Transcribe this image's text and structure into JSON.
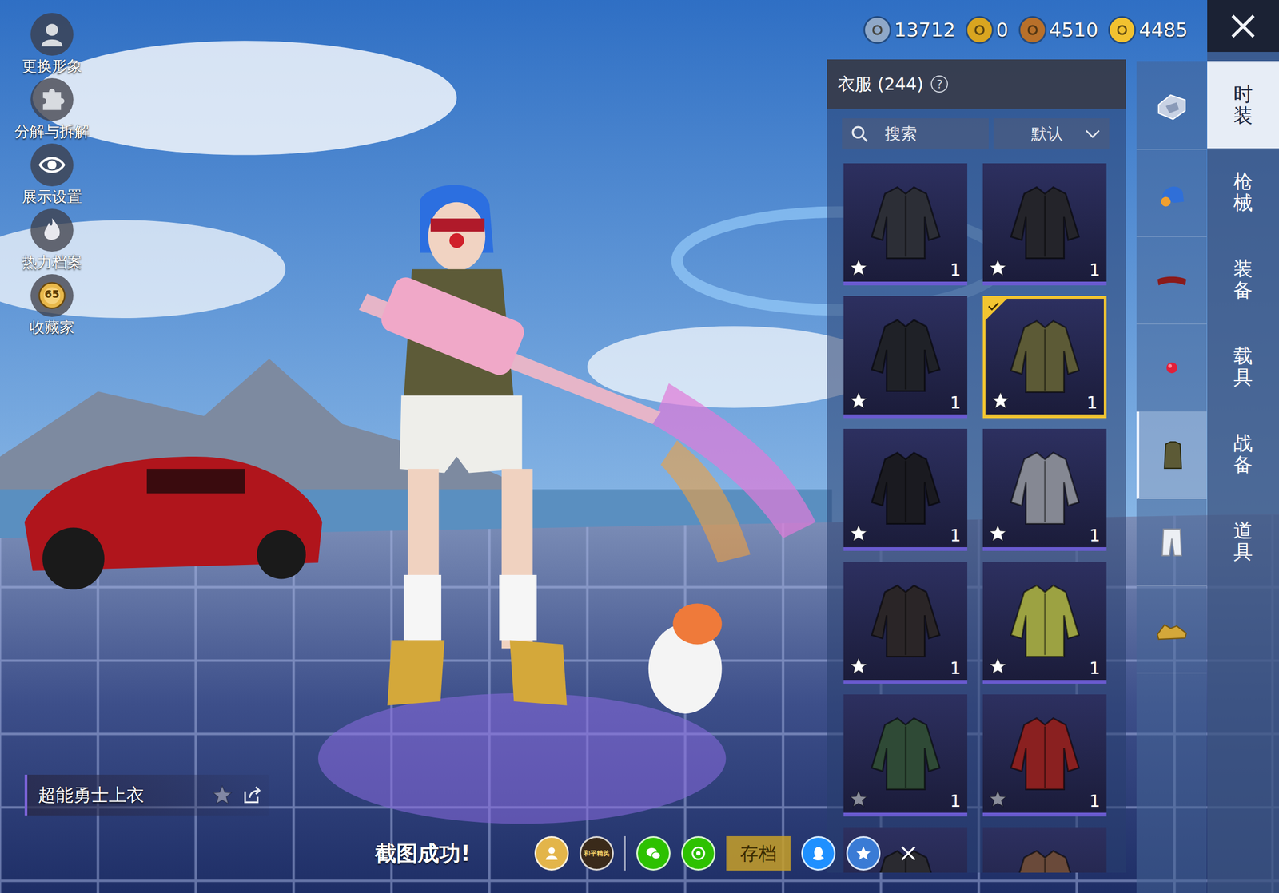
{
  "side_menu": {
    "items": [
      {
        "label": "更换形象",
        "kind": "avatar"
      },
      {
        "label": "分解与拆解",
        "kind": "puzzle"
      },
      {
        "label": "展示设置",
        "kind": "eye"
      },
      {
        "label": "热力档案",
        "kind": "flame"
      },
      {
        "label": "收藏家",
        "kind": "badge",
        "badge": "65"
      }
    ]
  },
  "currencies": [
    {
      "amount": "13712",
      "color": "#8fa8c8"
    },
    {
      "amount": "0",
      "color": "#d9a520"
    },
    {
      "amount": "4510",
      "color": "#b8702a"
    },
    {
      "amount": "4485",
      "color": "#f2c230"
    }
  ],
  "panel": {
    "title": "衣服 (244)",
    "help": "?",
    "search": {
      "label": "搜索"
    },
    "sort": {
      "label": "默认"
    }
  },
  "items": [
    {
      "kind": "full",
      "count": "1",
      "favorite": true,
      "selected": false,
      "color": "#2c2e36"
    },
    {
      "kind": "full",
      "count": "1",
      "favorite": true,
      "selected": false,
      "color": "#24242a"
    },
    {
      "kind": "full",
      "count": "1",
      "favorite": true,
      "selected": false,
      "color": "#1f2127"
    },
    {
      "kind": "full",
      "count": "1",
      "favorite": true,
      "selected": true,
      "color": "#5c5a36"
    },
    {
      "kind": "full",
      "count": "1",
      "favorite": true,
      "selected": false,
      "color": "#1a1a20"
    },
    {
      "kind": "full",
      "count": "1",
      "favorite": true,
      "selected": false,
      "color": "#858893"
    },
    {
      "kind": "full",
      "count": "1",
      "favorite": true,
      "selected": false,
      "color": "#2a2527"
    },
    {
      "kind": "full",
      "count": "1",
      "favorite": true,
      "selected": false,
      "color": "#9ca242"
    },
    {
      "kind": "full",
      "count": "1",
      "favorite": false,
      "selected": false,
      "color": "#2f4a36"
    },
    {
      "kind": "full",
      "count": "1",
      "favorite": false,
      "selected": false,
      "color": "#8a2020"
    },
    {
      "kind": "cut",
      "selected": false,
      "color": "#2a2a30"
    },
    {
      "kind": "cut",
      "selected": false,
      "color": "#6a4a3a"
    }
  ],
  "categories": [
    {
      "kind": "logo",
      "selected": false
    },
    {
      "kind": "helmet",
      "selected": false
    },
    {
      "kind": "waist",
      "selected": false
    },
    {
      "kind": "ball",
      "selected": false
    },
    {
      "kind": "top",
      "selected": true
    },
    {
      "kind": "pants",
      "selected": false
    },
    {
      "kind": "shoes",
      "selected": false
    }
  ],
  "tabs": [
    {
      "label": "时装",
      "selected": true
    },
    {
      "label": "枪械",
      "selected": false
    },
    {
      "label": "装备",
      "selected": false
    },
    {
      "label": "载具",
      "selected": false
    },
    {
      "label": "战备",
      "selected": false
    },
    {
      "label": "道具",
      "selected": false
    }
  ],
  "preview": {
    "name": "超能勇士上衣",
    "favorite": false
  },
  "toast": {
    "text": "截图成功!",
    "logo_text": "和平精英",
    "save": "存档",
    "share": [
      {
        "kind": "profile",
        "color": "#e3b54a"
      },
      {
        "kind": "logo",
        "color": "#3a2a1a"
      },
      {
        "kind": "wechat",
        "color": "#2dc100"
      },
      {
        "kind": "moments",
        "color": "#2dc100"
      },
      {
        "kind": "qq",
        "color": "#1e90ff"
      },
      {
        "kind": "qzone",
        "color": "#3a7bd5"
      },
      {
        "kind": "close",
        "color": "#00000000"
      }
    ]
  }
}
